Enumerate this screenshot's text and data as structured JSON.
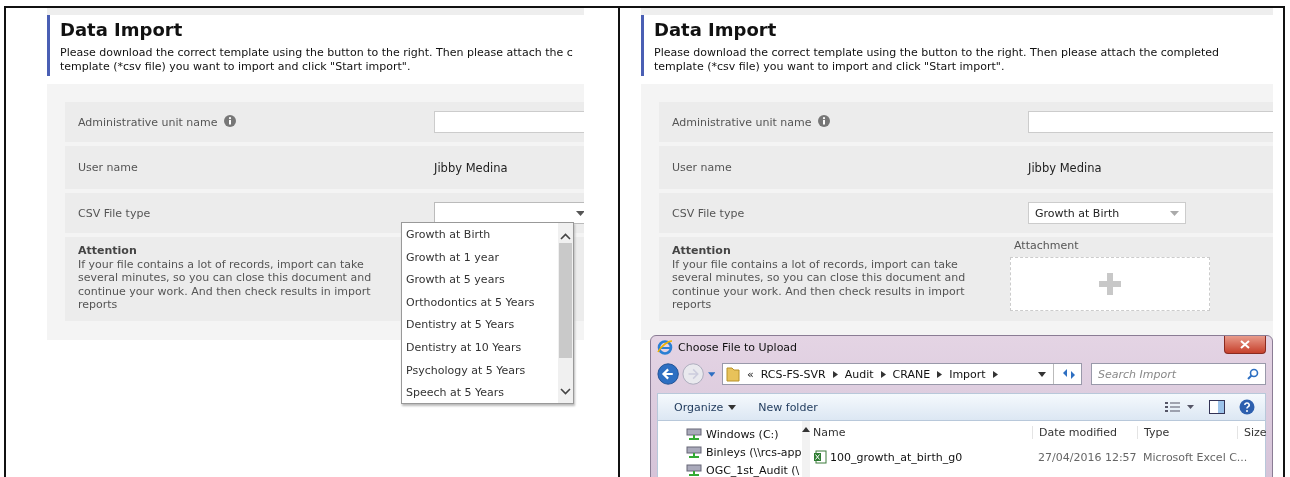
{
  "panels": [
    {
      "title": "Data Import",
      "description": "Please download the correct template using the button to the right. Then please attach the c\ntemplate (*csv file) you want to import and click \"Start import\".",
      "fields": [
        {
          "kind": "input",
          "label": "Administrative unit name",
          "info": true
        },
        {
          "kind": "text",
          "label": "User name",
          "value": "Jibby Medina"
        },
        {
          "kind": "select",
          "label": "CSV File type",
          "open": true
        },
        {
          "kind": "note",
          "label": "Attention",
          "text": "If your file contains a lot of records, import can take several minutes, so you can close this document and continue your work. And then check results in import reports"
        }
      ],
      "dropdown": {
        "options": [
          "Growth at Birth",
          "Growth at 1 year",
          "Growth at 5 years",
          "Orthodontics at 5 Years",
          "Dentistry at 5 Years",
          "Dentistry at 10 Years",
          "Psychology at 5 Years",
          "Speech at 5 Years"
        ]
      }
    },
    {
      "title": "Data Import",
      "description": "Please download the correct template using the button to the right. Then please attach the completed\ntemplate (*csv file) you want to import and click \"Start import\".",
      "fields": [
        {
          "kind": "input",
          "label": "Administrative unit name",
          "info": true
        },
        {
          "kind": "text",
          "label": "User name",
          "value": "Jibby Medina"
        },
        {
          "kind": "select",
          "label": "CSV File type",
          "value": "Growth at Birth",
          "open": false
        },
        {
          "kind": "note",
          "label": "Attention",
          "text": "If your file contains a lot of records, import can take several minutes, so you can close this document and continue your work. And then check results in import reports"
        }
      ],
      "attachment": {
        "label": "Attachment"
      },
      "dialog": {
        "title": "Choose File to Upload",
        "overflow_mark": "«",
        "path": [
          "RCS-FS-SVR",
          "Audit",
          "CRANE",
          "Import"
        ],
        "search": {
          "placeholder": "Search Import"
        },
        "toolbar": [
          "Organize",
          "New folder"
        ],
        "tree": [
          "Windows (C:)",
          "Binleys (\\\\rcs-app",
          "OGC_1st_Audit (\\"
        ],
        "columns": [
          "Name",
          "Date modified",
          "Type",
          "Size"
        ],
        "files": [
          {
            "name": "100_growth_at_birth_g0",
            "date": "27/04/2016 12:57",
            "type": "Microsoft Excel C..."
          }
        ]
      }
    }
  ]
}
